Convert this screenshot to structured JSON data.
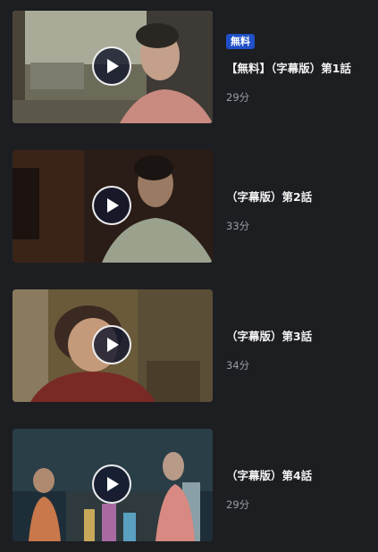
{
  "episodes": [
    {
      "badge": "無料",
      "title": "【無料】（字幕版）第1話",
      "duration": "29分"
    },
    {
      "badge": "",
      "title": "（字幕版）第2話",
      "duration": "33分"
    },
    {
      "badge": "",
      "title": "（字幕版）第3話",
      "duration": "34分"
    },
    {
      "badge": "",
      "title": "（字幕版）第4話",
      "duration": "29分"
    }
  ],
  "icons": {
    "play": "play-icon"
  },
  "colors": {
    "background": "#1d1e22",
    "badge": "#2050c8",
    "title": "#f2f2f2",
    "duration": "#9a9ca3"
  }
}
